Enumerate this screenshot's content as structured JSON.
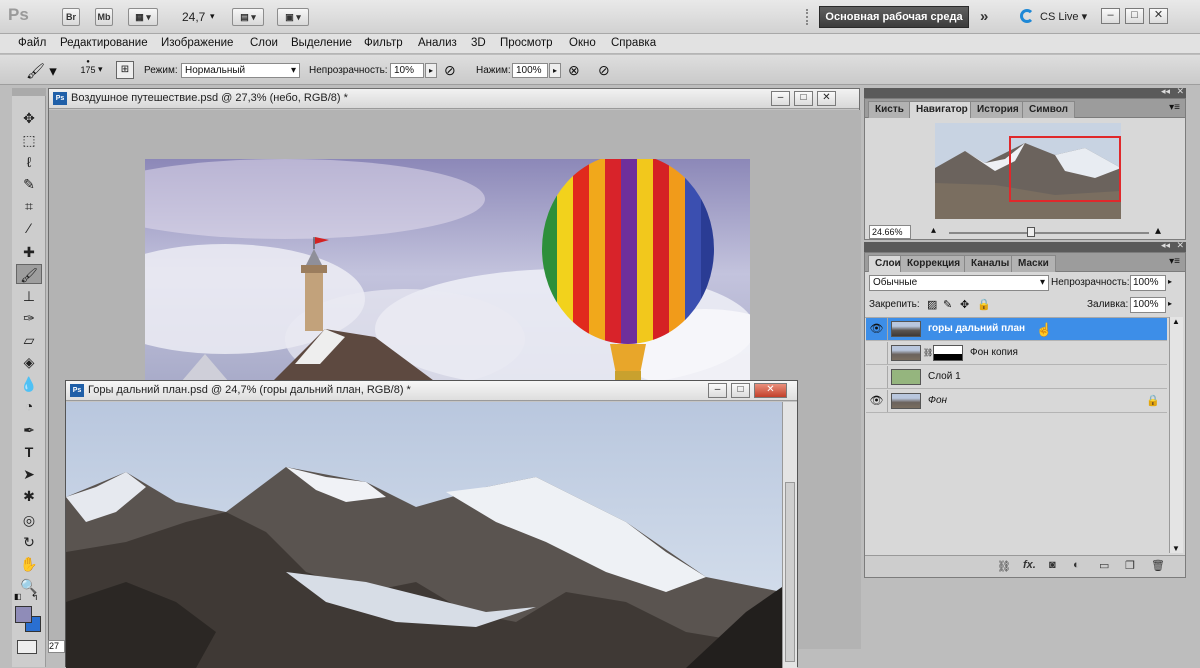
{
  "app": {
    "logo": "Ps",
    "bridge": "Br",
    "mini_bridge": "Mb",
    "zoom": "24,7",
    "workspace": "Основная рабочая среда",
    "more": "»",
    "cs_live": "CS Live"
  },
  "menu": [
    "Файл",
    "Редактирование",
    "Изображение",
    "Слои",
    "Выделение",
    "Фильтр",
    "Анализ",
    "3D",
    "Просмотр",
    "Окно",
    "Справка"
  ],
  "options": {
    "brush_size": "175",
    "mode_label": "Режим:",
    "mode_value": "Нормальный",
    "opacity_label": "Непрозрачность:",
    "opacity_value": "10%",
    "flow_label": "Нажим:",
    "flow_value": "100%"
  },
  "doc1": {
    "title": "Воздушное путешествие.psd @ 27,3% (небо, RGB/8) *"
  },
  "doc2": {
    "title": "Горы дальний план.psd @ 24,7% (горы дальний план, RGB/8) *",
    "zoom_partial": "27"
  },
  "navigator": {
    "tabs": [
      "Кисть",
      "Навигатор",
      "История",
      "Символ"
    ],
    "active_tab": 1,
    "zoom": "24.66%"
  },
  "layers": {
    "tabs": [
      "Слои",
      "Коррекция",
      "Каналы",
      "Маски"
    ],
    "blend_mode": "Обычные",
    "opacity_label": "Непрозрачность:",
    "opacity_value": "100%",
    "lock_label": "Закрепить:",
    "fill_label": "Заливка:",
    "fill_value": "100%",
    "items": [
      {
        "name": "горы дальний план",
        "visible": true,
        "selected": true
      },
      {
        "name": "Фон копия",
        "visible": false,
        "selected": false
      },
      {
        "name": "Слой 1",
        "visible": false,
        "selected": false
      },
      {
        "name": "Фон",
        "visible": true,
        "selected": false
      }
    ]
  },
  "colors": {
    "accent": "#3d8ee8",
    "foreground": "#8f8cb8",
    "background": "#2a6fd1",
    "navigator_frame": "#e0282b"
  }
}
